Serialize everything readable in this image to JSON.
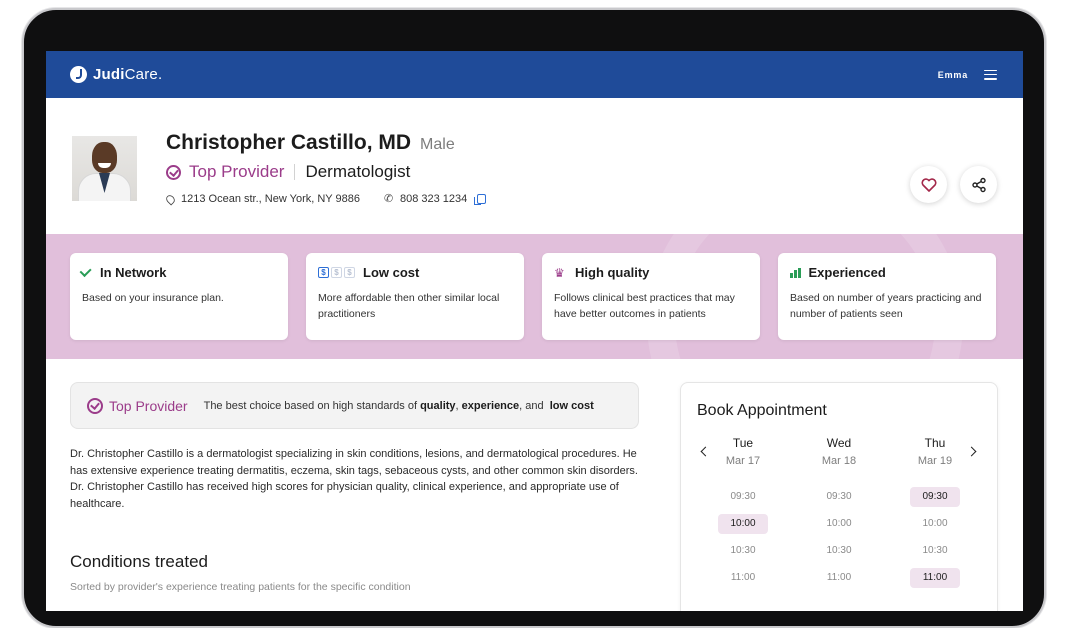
{
  "header": {
    "logo_bold": "Judi",
    "logo_light": "Care.",
    "user_name": "Emma"
  },
  "profile": {
    "name": "Christopher Castillo, MD",
    "gender": "Male",
    "badge": "Top Provider",
    "specialty": "Dermatologist",
    "address": "1213 Ocean str., New York, NY 9886",
    "phone": "808 323 1234"
  },
  "features": [
    {
      "title": "In Network",
      "desc": "Based on your insurance plan.",
      "icon": "check-icon"
    },
    {
      "title": "Low cost",
      "desc": "More affordable then other similar local practitioners",
      "icon": "dollar-icon"
    },
    {
      "title": "High quality",
      "desc": "Follows clinical best practices that may have better outcomes in patients",
      "icon": "crown-icon"
    },
    {
      "title": "Experienced",
      "desc": "Based on number of years practicing and number of patients seen",
      "icon": "bar-chart-icon"
    }
  ],
  "top_provider_box": {
    "label": "Top Provider",
    "text_prefix": "The best choice based on high standards of",
    "quality": "quality",
    "comma": ",",
    "experience": "experience",
    "and": ", and",
    "low_cost": "low cost"
  },
  "bio": "Dr. Christopher Castillo is a dermatologist specializing in skin conditions, lesions, and dermatological procedures. He has extensive experience treating dermatitis, eczema, skin tags, sebaceous cysts, and other common skin disorders. Dr. Christopher Castillo has received high scores for physician quality, clinical experience, and appropriate use of healthcare.",
  "conditions": {
    "title": "Conditions treated",
    "subtitle": "Sorted by provider's experience treating patients for the specific condition"
  },
  "booking": {
    "title": "Book Appointment",
    "days": [
      {
        "day": "Tue",
        "date": "Mar 17",
        "slots": [
          "09:30",
          "10:00",
          "10:30",
          "11:00"
        ],
        "selected": [
          1
        ]
      },
      {
        "day": "Wed",
        "date": "Mar 18",
        "slots": [
          "09:30",
          "10:00",
          "10:30",
          "11:00"
        ],
        "selected": []
      },
      {
        "day": "Thu",
        "date": "Mar 19",
        "slots": [
          "09:30",
          "10:00",
          "10:30",
          "11:00"
        ],
        "selected": [
          0,
          3
        ]
      }
    ]
  },
  "colors": {
    "header": "#1f4b99",
    "accent": "#9b3c8a",
    "band": "#e1bfdb",
    "link": "#2e6fd6",
    "success": "#2a9d57"
  }
}
